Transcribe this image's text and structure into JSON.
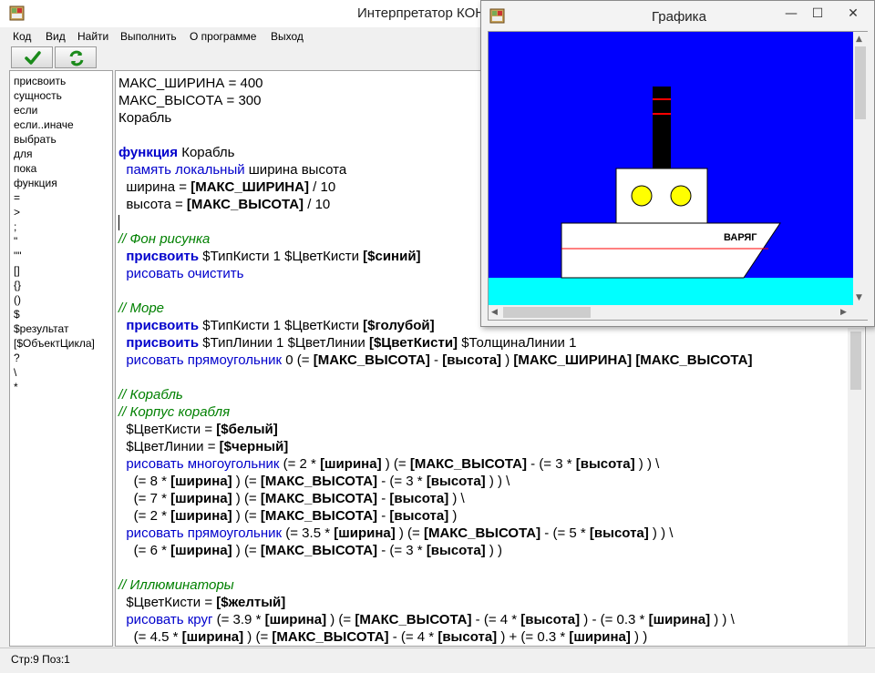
{
  "main_window": {
    "title": "Интерпретатор КОНТ",
    "menu": [
      "Код",
      "Вид",
      "Найти",
      "Выполнить",
      "О программе",
      "Выход"
    ],
    "toolbar": {
      "run_icon": "checkmark-icon",
      "refresh_icon": "refresh-icon"
    },
    "keywords": [
      "присвоить",
      "сущность",
      "если",
      "если..иначе",
      "выбрать",
      "для",
      "пока",
      "функция",
      "=",
      ">",
      ";",
      "\"",
      "\"\"",
      "[]",
      "{}",
      "()",
      "$",
      "$результат",
      "[$ОбъектЦикла]",
      "?",
      "\\",
      "*"
    ],
    "code_lines": [
      [
        {
          "t": "МАКС_ШИРИНА = 400",
          "c": "p"
        }
      ],
      [
        {
          "t": "МАКС_ВЫСОТА = 300",
          "c": "p"
        }
      ],
      [
        {
          "t": "Корабль",
          "c": "p"
        }
      ],
      [],
      [
        {
          "t": "функция",
          "c": "kb"
        },
        {
          "t": " Корабль",
          "c": "p"
        }
      ],
      [
        {
          "t": "  ",
          "c": "p"
        },
        {
          "t": "память локальный",
          "c": "kn"
        },
        {
          "t": " ширина высота",
          "c": "p"
        }
      ],
      [
        {
          "t": "  ширина = ",
          "c": "p"
        },
        {
          "t": "[МАКС_ШИРИНА]",
          "c": "b"
        },
        {
          "t": " / 10",
          "c": "p"
        }
      ],
      [
        {
          "t": "  высота = ",
          "c": "p"
        },
        {
          "t": "[МАКС_ВЫСОТА]",
          "c": "b"
        },
        {
          "t": " / 10",
          "c": "p"
        }
      ],
      [
        {
          "t": "",
          "c": "caret"
        }
      ],
      [
        {
          "t": "// Фон рисунка",
          "c": "cm"
        }
      ],
      [
        {
          "t": "  ",
          "c": "p"
        },
        {
          "t": "присвоить",
          "c": "kb"
        },
        {
          "t": " $ТипКисти 1 $ЦветКисти ",
          "c": "p"
        },
        {
          "t": "[$синий]",
          "c": "b"
        }
      ],
      [
        {
          "t": "  ",
          "c": "p"
        },
        {
          "t": "рисовать очистить",
          "c": "kn"
        }
      ],
      [],
      [
        {
          "t": "// Море",
          "c": "cm"
        }
      ],
      [
        {
          "t": "  ",
          "c": "p"
        },
        {
          "t": "присвоить",
          "c": "kb"
        },
        {
          "t": " $ТипКисти 1 $ЦветКисти ",
          "c": "p"
        },
        {
          "t": "[$голубой]",
          "c": "b"
        }
      ],
      [
        {
          "t": "  ",
          "c": "p"
        },
        {
          "t": "присвоить",
          "c": "kb"
        },
        {
          "t": " $ТипЛинии 1 $ЦветЛинии ",
          "c": "p"
        },
        {
          "t": "[$ЦветКисти]",
          "c": "b"
        },
        {
          "t": " $ТолщинаЛинии 1",
          "c": "p"
        }
      ],
      [
        {
          "t": "  ",
          "c": "p"
        },
        {
          "t": "рисовать прямоугольник",
          "c": "kn"
        },
        {
          "t": " 0 (= ",
          "c": "p"
        },
        {
          "t": "[МАКС_ВЫСОТА]",
          "c": "b"
        },
        {
          "t": " - ",
          "c": "p"
        },
        {
          "t": "[высота]",
          "c": "b"
        },
        {
          "t": " ) ",
          "c": "p"
        },
        {
          "t": "[МАКС_ШИРИНА] [МАКС_ВЫСОТА]",
          "c": "b"
        }
      ],
      [],
      [
        {
          "t": "// Корабль",
          "c": "cm"
        }
      ],
      [
        {
          "t": "// Корпус корабля",
          "c": "cm"
        }
      ],
      [
        {
          "t": "  $ЦветКисти = ",
          "c": "p"
        },
        {
          "t": "[$белый]",
          "c": "b"
        }
      ],
      [
        {
          "t": "  $ЦветЛинии = ",
          "c": "p"
        },
        {
          "t": "[$черный]",
          "c": "b"
        }
      ],
      [
        {
          "t": "  ",
          "c": "p"
        },
        {
          "t": "рисовать многоугольник",
          "c": "kn"
        },
        {
          "t": " (= 2 * ",
          "c": "p"
        },
        {
          "t": "[ширина]",
          "c": "b"
        },
        {
          "t": " ) (= ",
          "c": "p"
        },
        {
          "t": "[МАКС_ВЫСОТА]",
          "c": "b"
        },
        {
          "t": " - (= 3 * ",
          "c": "p"
        },
        {
          "t": "[высота]",
          "c": "b"
        },
        {
          "t": " ) ) \\",
          "c": "p"
        }
      ],
      [
        {
          "t": "    (= 8 * ",
          "c": "p"
        },
        {
          "t": "[ширина]",
          "c": "b"
        },
        {
          "t": " ) (= ",
          "c": "p"
        },
        {
          "t": "[МАКС_ВЫСОТА]",
          "c": "b"
        },
        {
          "t": " - (= 3 * ",
          "c": "p"
        },
        {
          "t": "[высота]",
          "c": "b"
        },
        {
          "t": " ) ) \\",
          "c": "p"
        }
      ],
      [
        {
          "t": "    (= 7 * ",
          "c": "p"
        },
        {
          "t": "[ширина]",
          "c": "b"
        },
        {
          "t": " ) (= ",
          "c": "p"
        },
        {
          "t": "[МАКС_ВЫСОТА]",
          "c": "b"
        },
        {
          "t": " - ",
          "c": "p"
        },
        {
          "t": "[высота]",
          "c": "b"
        },
        {
          "t": " ) \\",
          "c": "p"
        }
      ],
      [
        {
          "t": "    (= 2 * ",
          "c": "p"
        },
        {
          "t": "[ширина]",
          "c": "b"
        },
        {
          "t": " ) (= ",
          "c": "p"
        },
        {
          "t": "[МАКС_ВЫСОТА]",
          "c": "b"
        },
        {
          "t": " - ",
          "c": "p"
        },
        {
          "t": "[высота]",
          "c": "b"
        },
        {
          "t": " )",
          "c": "p"
        }
      ],
      [
        {
          "t": "  ",
          "c": "p"
        },
        {
          "t": "рисовать прямоугольник",
          "c": "kn"
        },
        {
          "t": " (= 3.5 * ",
          "c": "p"
        },
        {
          "t": "[ширина]",
          "c": "b"
        },
        {
          "t": " ) (= ",
          "c": "p"
        },
        {
          "t": "[МАКС_ВЫСОТА]",
          "c": "b"
        },
        {
          "t": " - (= 5 * ",
          "c": "p"
        },
        {
          "t": "[высота]",
          "c": "b"
        },
        {
          "t": " ) ) \\",
          "c": "p"
        }
      ],
      [
        {
          "t": "    (= 6 * ",
          "c": "p"
        },
        {
          "t": "[ширина]",
          "c": "b"
        },
        {
          "t": " ) (= ",
          "c": "p"
        },
        {
          "t": "[МАКС_ВЫСОТА]",
          "c": "b"
        },
        {
          "t": " - (= 3 * ",
          "c": "p"
        },
        {
          "t": "[высота]",
          "c": "b"
        },
        {
          "t": " ) )",
          "c": "p"
        }
      ],
      [],
      [
        {
          "t": "// Иллюминаторы",
          "c": "cm"
        }
      ],
      [
        {
          "t": "  $ЦветКисти = ",
          "c": "p"
        },
        {
          "t": "[$желтый]",
          "c": "b"
        }
      ],
      [
        {
          "t": "  ",
          "c": "p"
        },
        {
          "t": "рисовать круг",
          "c": "kn"
        },
        {
          "t": " (= 3.9 * ",
          "c": "p"
        },
        {
          "t": "[ширина]",
          "c": "b"
        },
        {
          "t": " ) (= ",
          "c": "p"
        },
        {
          "t": "[МАКС_ВЫСОТА]",
          "c": "b"
        },
        {
          "t": " - (= 4 * ",
          "c": "p"
        },
        {
          "t": "[высота]",
          "c": "b"
        },
        {
          "t": " ) - (= 0.3 * ",
          "c": "p"
        },
        {
          "t": "[ширина]",
          "c": "b"
        },
        {
          "t": " ) ) \\",
          "c": "p"
        }
      ],
      [
        {
          "t": "    (= 4.5 * ",
          "c": "p"
        },
        {
          "t": "[ширина]",
          "c": "b"
        },
        {
          "t": " ) (= ",
          "c": "p"
        },
        {
          "t": "[МАКС_ВЫСОТА]",
          "c": "b"
        },
        {
          "t": " - (= 4 * ",
          "c": "p"
        },
        {
          "t": "[высота]",
          "c": "b"
        },
        {
          "t": " ) + (= 0.3 * ",
          "c": "p"
        },
        {
          "t": "[ширина]",
          "c": "b"
        },
        {
          "t": " ) )",
          "c": "p"
        }
      ]
    ],
    "status": "Стр:9 Поз:1"
  },
  "graphics_window": {
    "title": "Графика",
    "buttons": {
      "minimize": "—",
      "maximize": "☐",
      "close": "✕"
    },
    "ship_name": "ВАРЯГ",
    "colors": {
      "sky": "#0000ff",
      "sea": "#00ffff",
      "hull": "#ffffff",
      "stack": "#000000",
      "stack_stripe": "#ff0000",
      "portholes": "#ffff00",
      "hull_line": "#ff0000"
    }
  },
  "code_colors": {
    "p": "#000000",
    "kb": "#0000cc",
    "kn": "#0000cc",
    "cm": "#008000",
    "b": "#000000"
  }
}
